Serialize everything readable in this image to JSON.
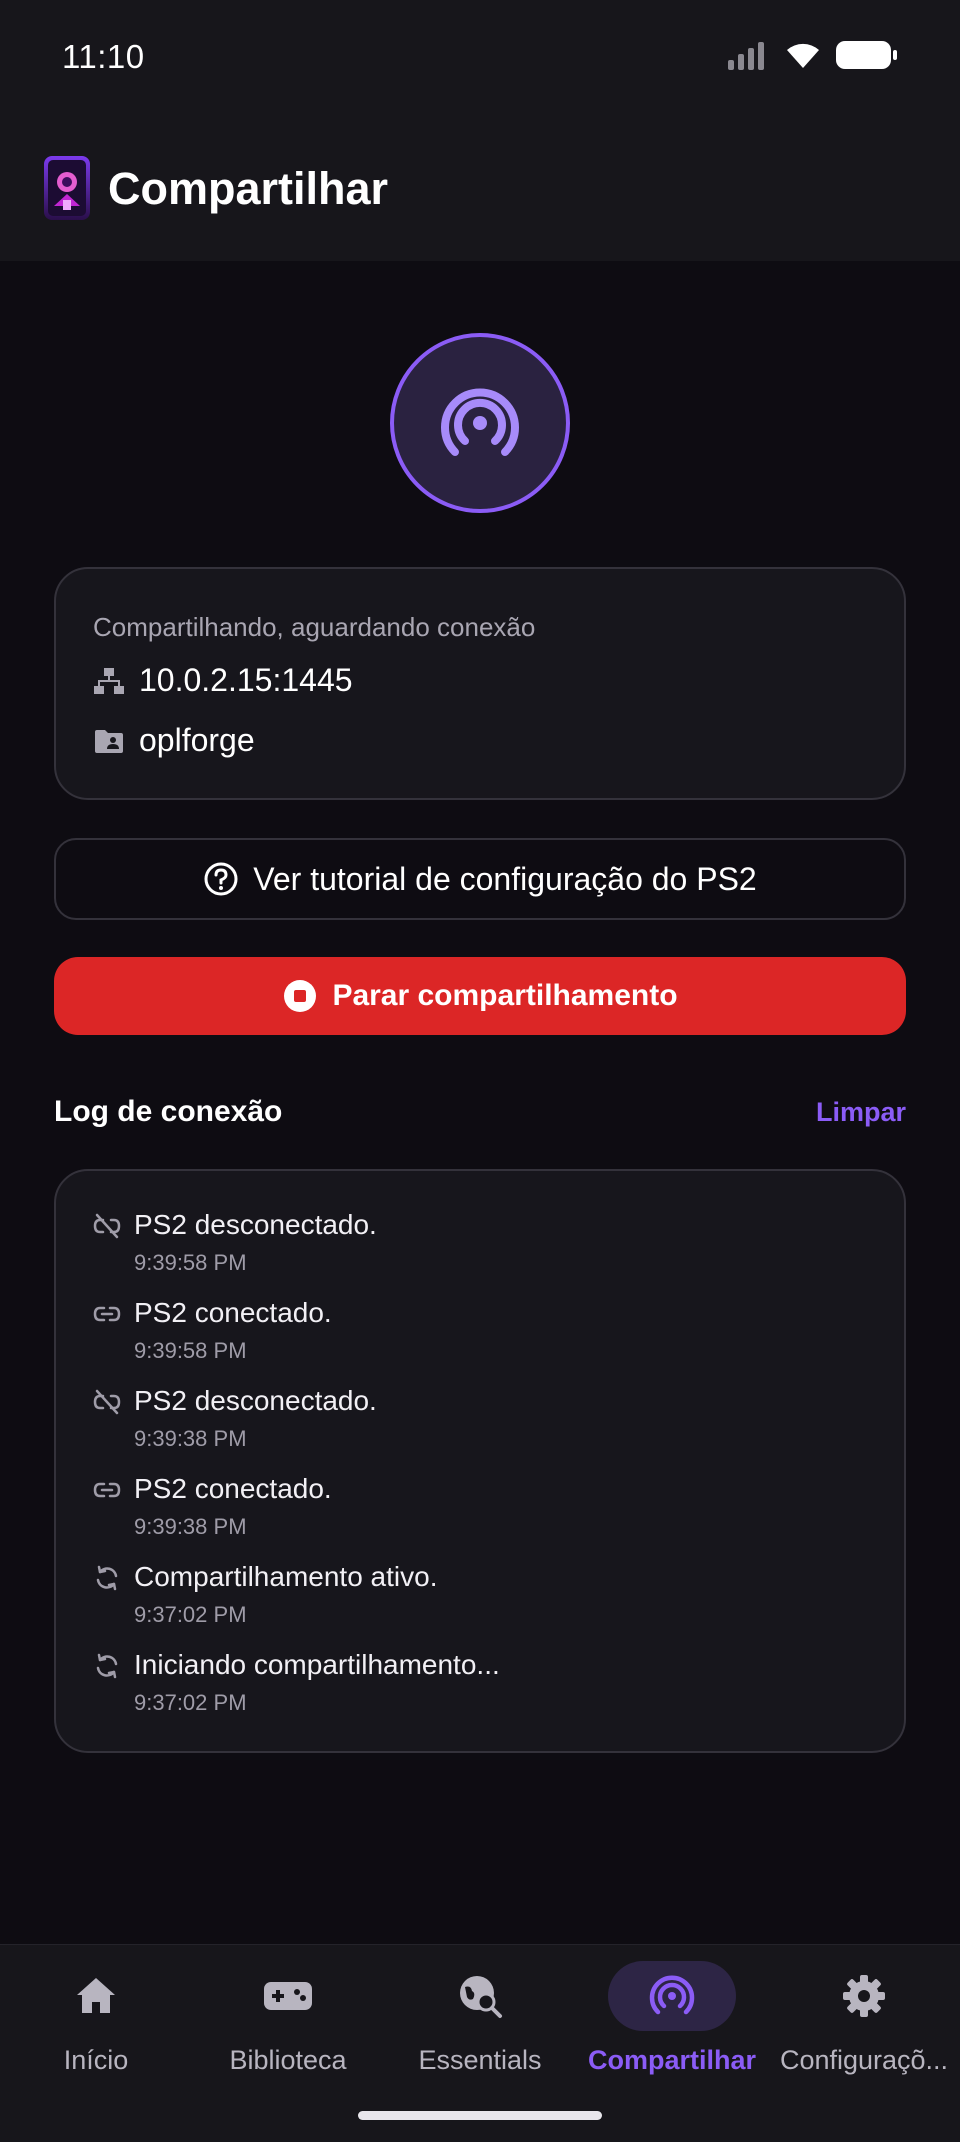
{
  "status_bar": {
    "time": "11:10"
  },
  "app_bar": {
    "title": "Compartilhar"
  },
  "share_info": {
    "status": "Compartilhando, aguardando conexão",
    "address": "10.0.2.15:1445",
    "folder": "oplforge"
  },
  "actions": {
    "tutorial_label": "Ver tutorial de configuração do PS2",
    "stop_label": "Parar compartilhamento"
  },
  "log": {
    "title": "Log de conexão",
    "clear_label": "Limpar",
    "entries": [
      {
        "icon": "link-off-icon",
        "message": "PS2 desconectado.",
        "time": "9:39:58 PM"
      },
      {
        "icon": "link-icon",
        "message": "PS2 conectado.",
        "time": "9:39:58 PM"
      },
      {
        "icon": "link-off-icon",
        "message": "PS2 desconectado.",
        "time": "9:39:38 PM"
      },
      {
        "icon": "link-icon",
        "message": "PS2 conectado.",
        "time": "9:39:38 PM"
      },
      {
        "icon": "sync-icon",
        "message": "Compartilhamento ativo.",
        "time": "9:37:02 PM"
      },
      {
        "icon": "sync-icon",
        "message": "Iniciando compartilhamento...",
        "time": "9:37:02 PM"
      }
    ]
  },
  "nav": {
    "items": [
      {
        "label": "Início",
        "icon": "home-icon",
        "active": false
      },
      {
        "label": "Biblioteca",
        "icon": "gamepad-icon",
        "active": false
      },
      {
        "label": "Essentials",
        "icon": "globe-search-icon",
        "active": false
      },
      {
        "label": "Compartilhar",
        "icon": "broadcast-icon",
        "active": true
      },
      {
        "label": "Configuraçõ...",
        "icon": "gear-icon",
        "active": false
      }
    ]
  },
  "colors": {
    "accent": "#8b5cf6",
    "danger": "#dc2626",
    "background": "#0e0c12",
    "surface": "#17161c"
  }
}
